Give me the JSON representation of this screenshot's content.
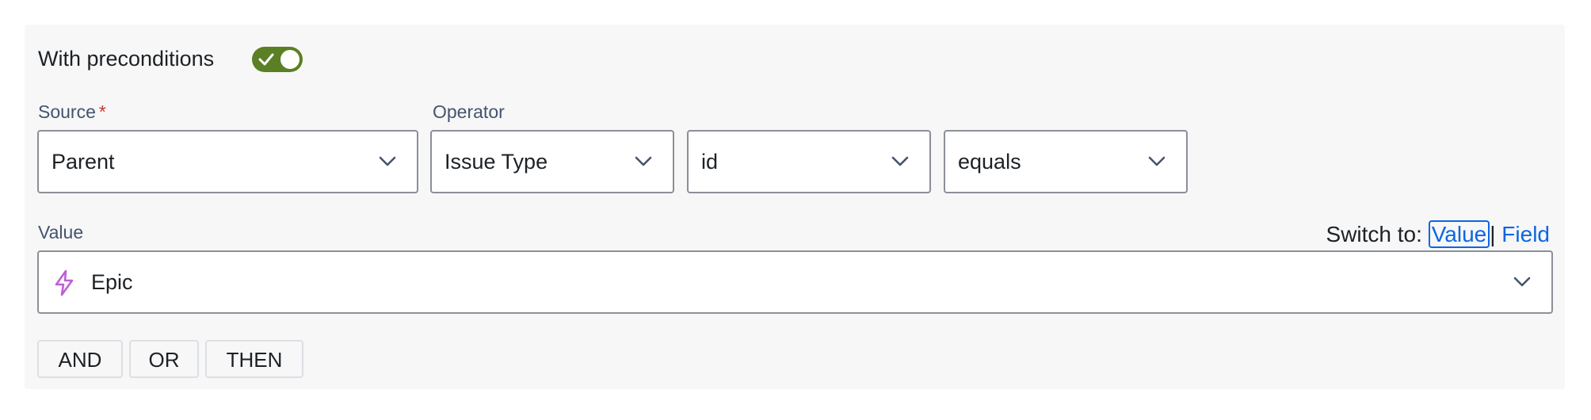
{
  "preconditions": {
    "label": "With preconditions",
    "enabled": true
  },
  "source": {
    "label": "Source",
    "required_mark": "*",
    "value": "Parent"
  },
  "operator": {
    "label": "Operator",
    "field": "Issue Type",
    "property": "id",
    "comparison": "equals"
  },
  "value_section": {
    "label": "Value",
    "switch_to_label": "Switch to:",
    "switch_options": [
      "Value",
      "Field"
    ],
    "active_option": "Value",
    "separator": "|",
    "selected": "Epic",
    "selected_icon": "lightning-bolt-icon"
  },
  "logic_buttons": [
    "AND",
    "OR",
    "THEN"
  ],
  "colors": {
    "toggle_on": "#5b7f24",
    "link": "#0c66e4",
    "required": "#c9372c",
    "epic_icon": "#c05fd6",
    "panel_bg": "#f7f7f7"
  }
}
